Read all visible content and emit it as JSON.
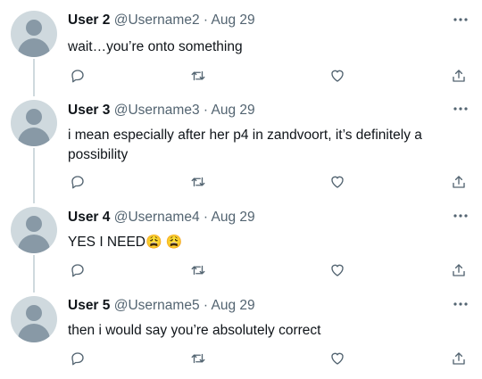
{
  "tweets": [
    {
      "name": "User 2",
      "handle": "@Username2",
      "sep": "·",
      "date": "Aug 29",
      "text": "wait…you’re onto something",
      "emoji": ""
    },
    {
      "name": "User 3",
      "handle": "@Username3",
      "sep": "·",
      "date": "Aug 29",
      "text": "i mean especially after her p4 in zandvoort, it’s definitely a possibility",
      "emoji": ""
    },
    {
      "name": "User 4",
      "handle": "@Username4",
      "sep": "·",
      "date": "Aug 29",
      "text": "YES I NEED",
      "emoji": "😩 😩"
    },
    {
      "name": "User 5",
      "handle": "@Username5",
      "sep": "·",
      "date": "Aug 29",
      "text": "then i would say you’re absolutely correct",
      "emoji": ""
    }
  ],
  "icons": {
    "more": "more-horizontal-icon",
    "reply": "reply-icon",
    "retweet": "retweet-icon",
    "like": "heart-icon",
    "share": "share-icon"
  },
  "colors": {
    "text": "#0f1419",
    "secondary": "#536471",
    "avatar_bg": "#cfd9de",
    "avatar_fg": "#8899a6",
    "thread_line": "#cfd9de"
  }
}
